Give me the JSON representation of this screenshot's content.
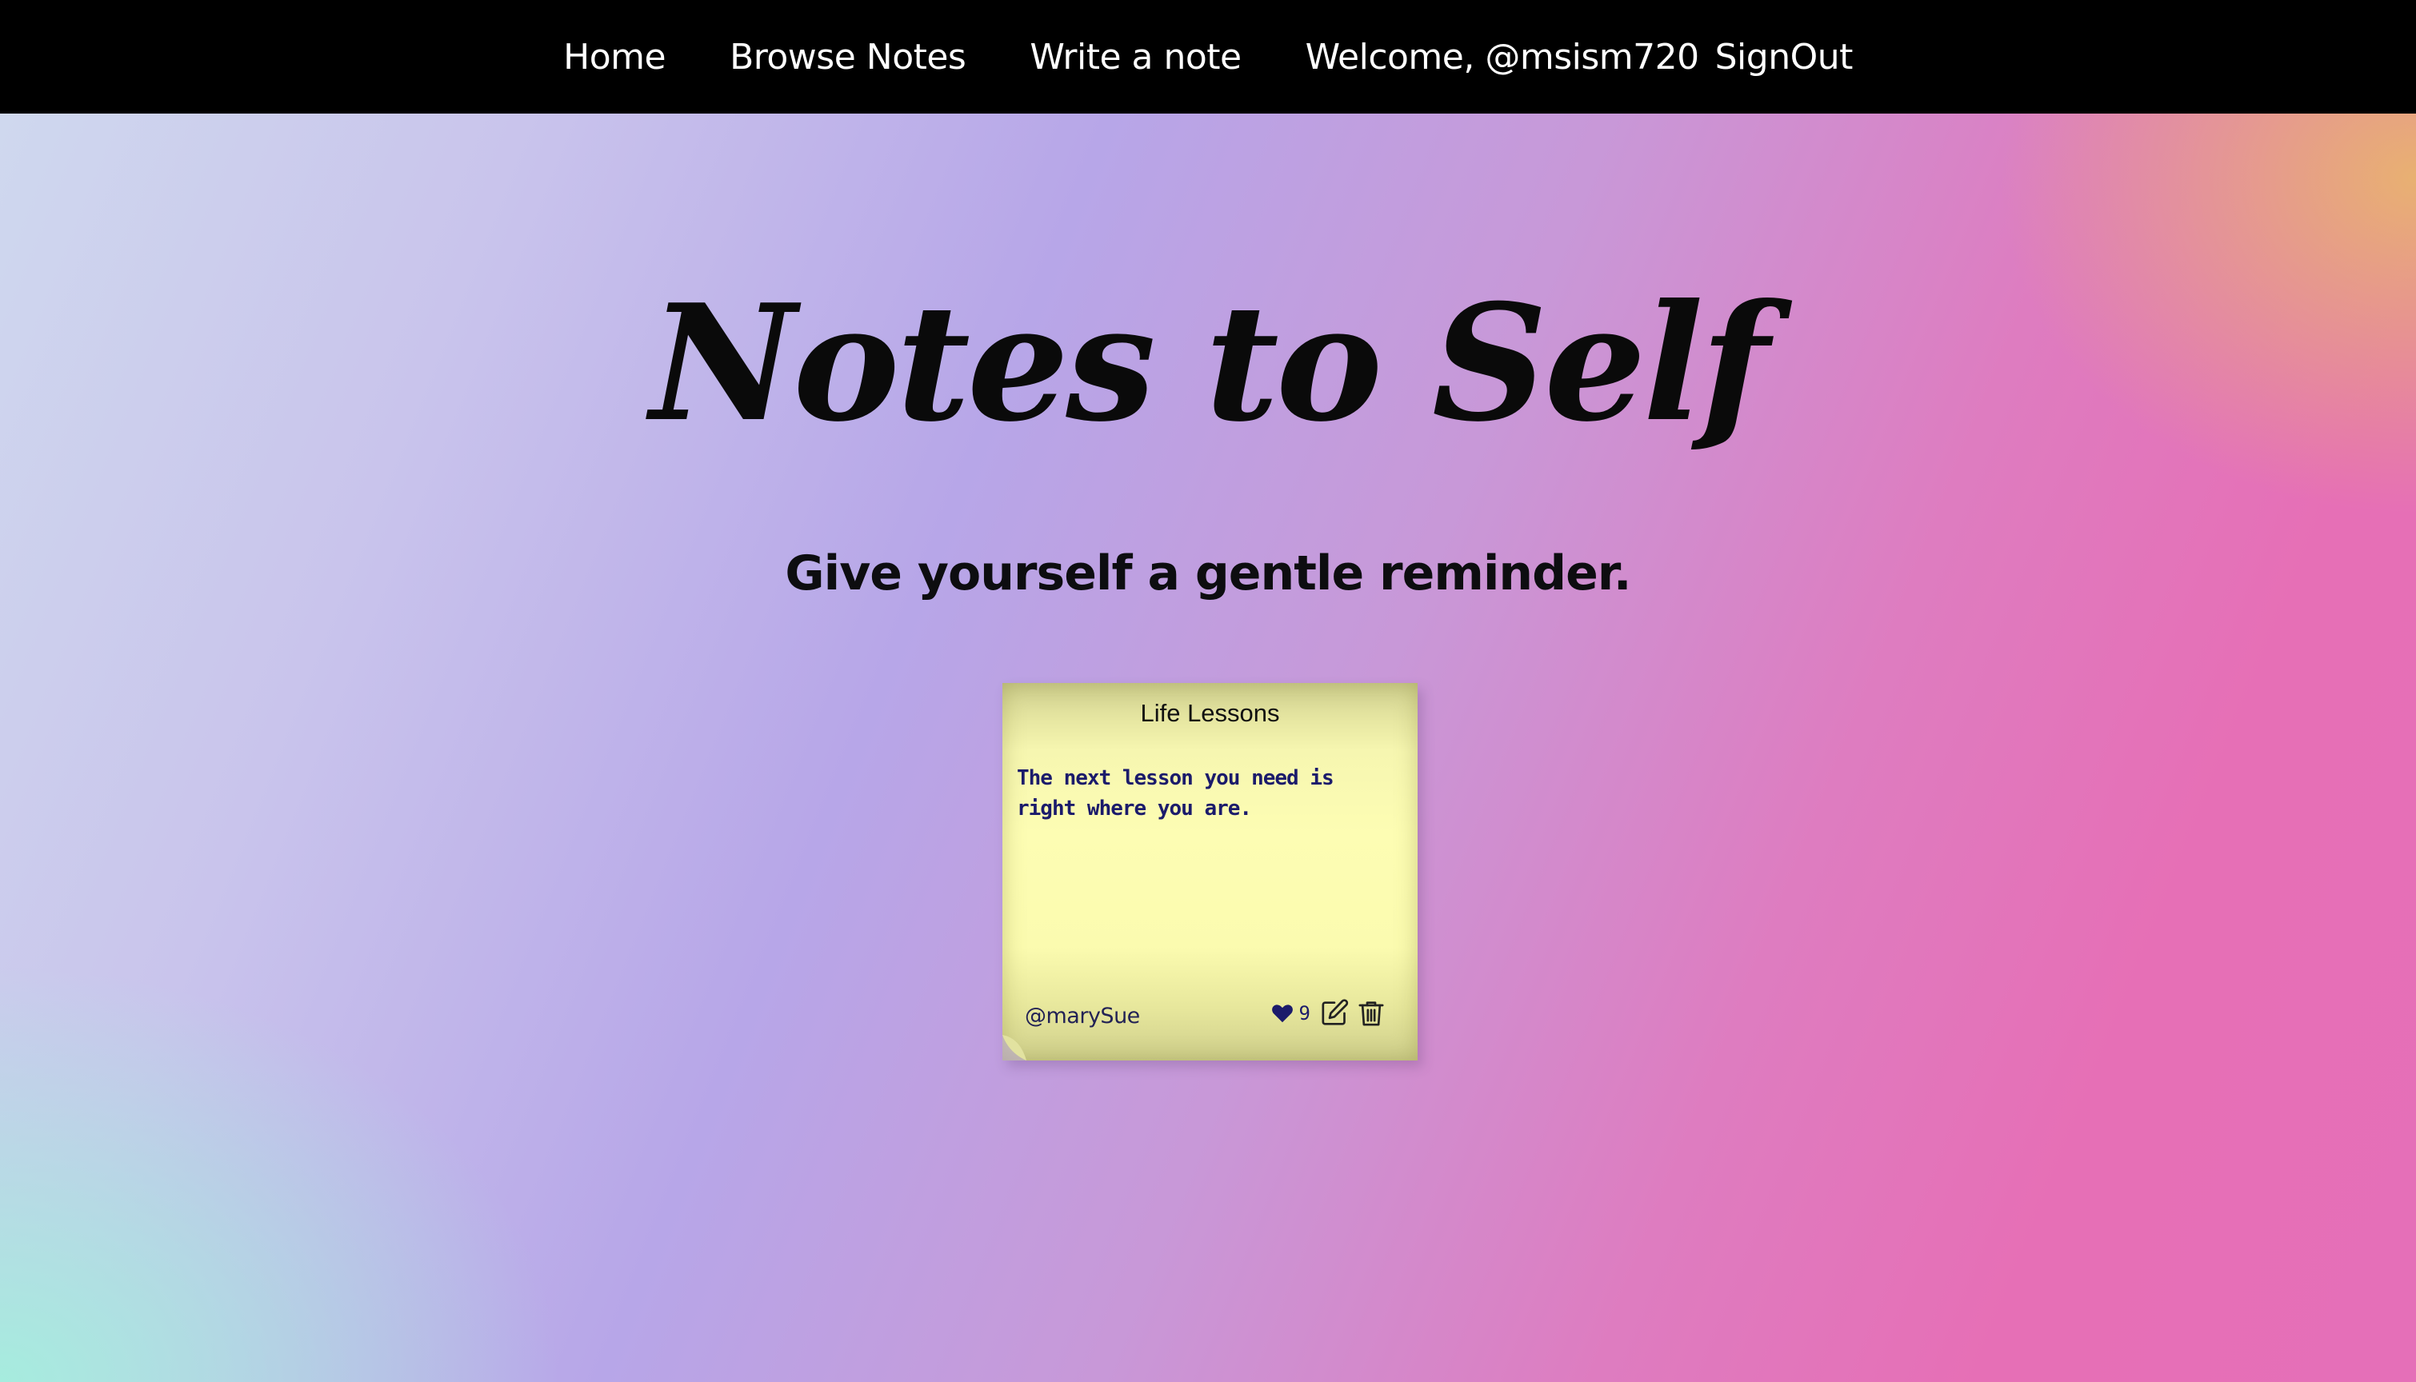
{
  "nav": {
    "home": "Home",
    "browse": "Browse Notes",
    "write": "Write a note",
    "welcome": "Welcome, @msism720",
    "signout": "SignOut"
  },
  "hero": {
    "title": "Notes to Self",
    "subtitle": "Give yourself a gentle reminder."
  },
  "note": {
    "title": "Life Lessons",
    "body": "The next lesson you need is right where you are.",
    "author": "@marySue",
    "likes": "9",
    "icons": [
      "heart-icon",
      "edit-icon",
      "trash-icon"
    ]
  },
  "colors": {
    "nav_bg": "#000000",
    "note_bg": "#fdfdb3",
    "note_text": "#1b1b6b"
  }
}
